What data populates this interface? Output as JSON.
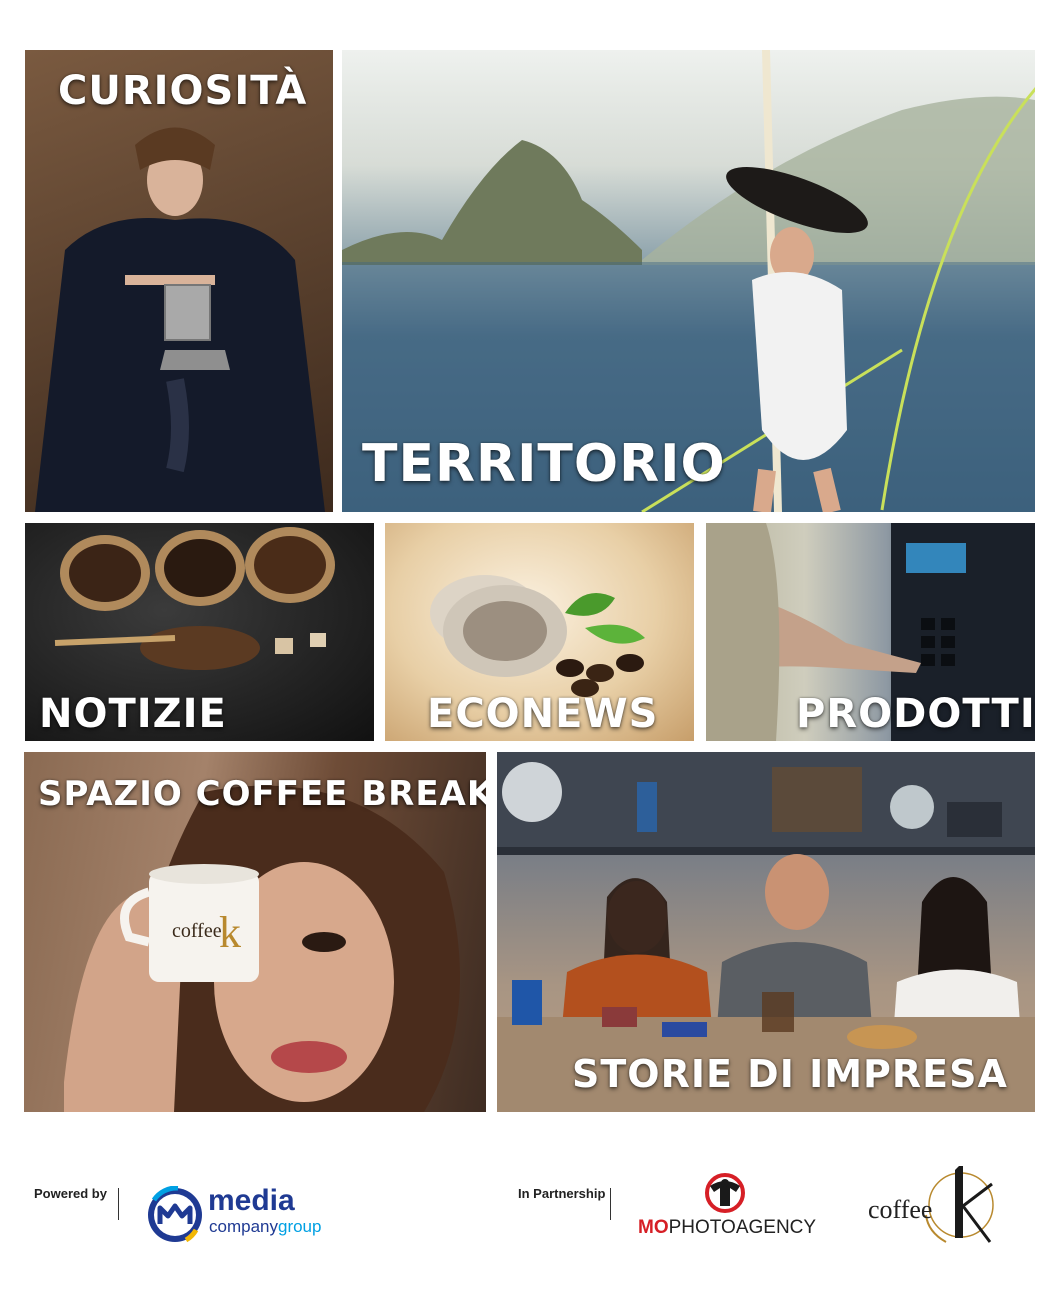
{
  "tiles": {
    "curiosita": "CURIOSITÀ",
    "territorio": "TERRITORIO",
    "notizie": "NOTIZIE",
    "econews": "ECONEWS",
    "prodotti": "PRODOTTI",
    "spazio_coffee_break": "SPAZIO COFFEE BREAK",
    "storie_di_impresa": "STORIE DI IMPRESA"
  },
  "footer": {
    "powered_by": "Powered by",
    "media_logo": {
      "line1": "media",
      "line2_a": "company",
      "line2_b": "group"
    },
    "in_partnership": "In Partnership",
    "mo_logo": {
      "mo": "MO",
      "rest": "PHOTOAGENCY"
    },
    "coffee_logo": "coffee"
  },
  "colors": {
    "media_blue": "#1f3a93",
    "media_accent": "#00a0e3",
    "mo_red": "#d61f26",
    "coffee_gold": "#b8892e"
  },
  "icons": [
    "media-company-logo-icon",
    "mo-photoagency-logo-icon",
    "coffee-k-logo-icon"
  ]
}
